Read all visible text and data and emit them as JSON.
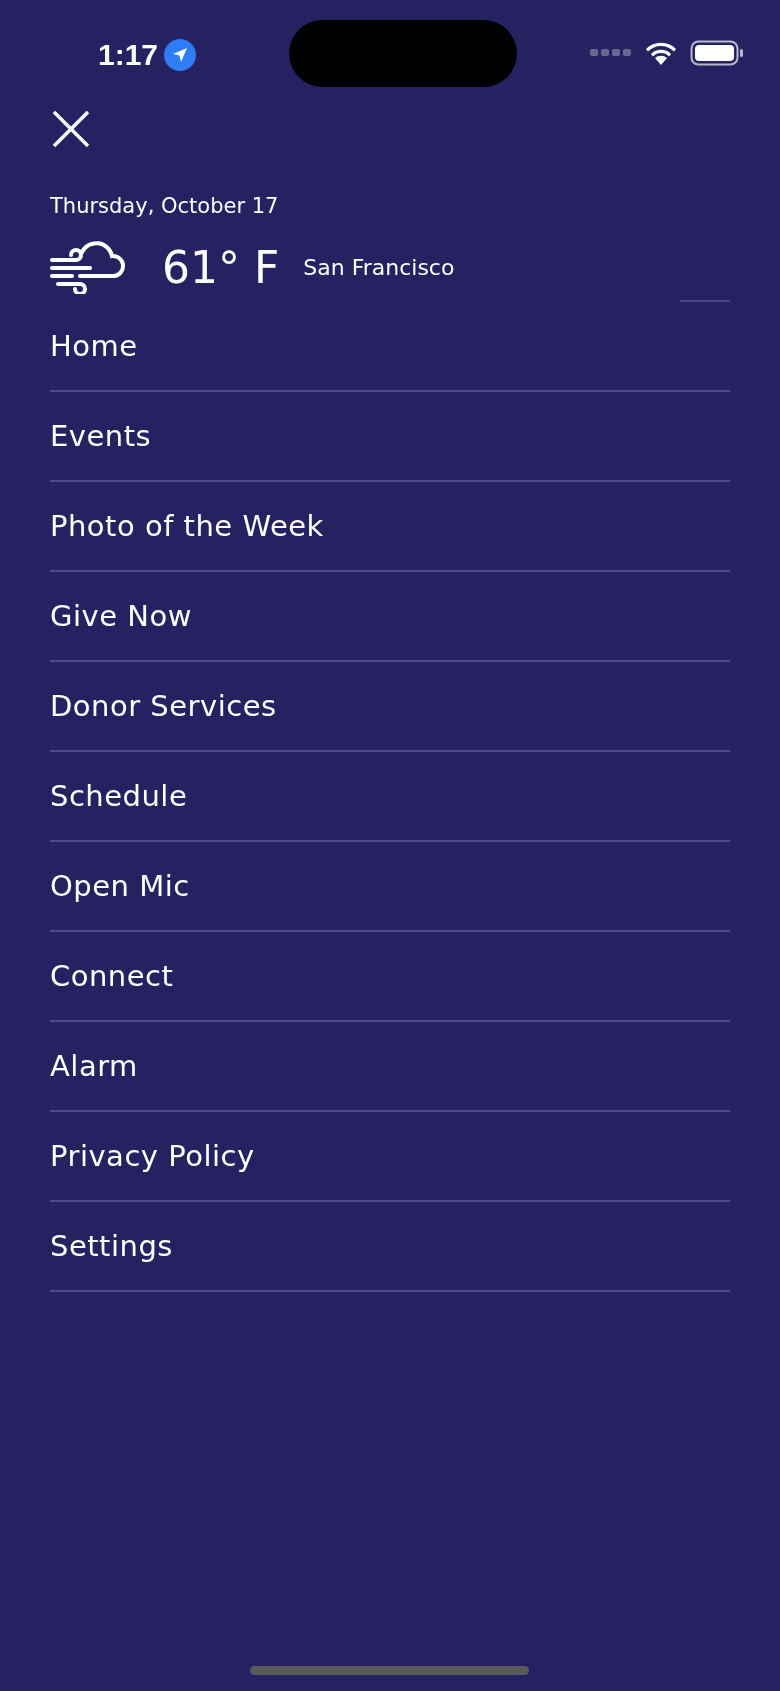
{
  "status_bar": {
    "time": "1:17",
    "location_active": true
  },
  "date": "Thursday, October 17",
  "weather": {
    "temperature": "61° F",
    "city": "San Francisco"
  },
  "menu": [
    {
      "label": "Home"
    },
    {
      "label": "Events"
    },
    {
      "label": "Photo of the Week"
    },
    {
      "label": "Give Now"
    },
    {
      "label": "Donor Services"
    },
    {
      "label": "Schedule"
    },
    {
      "label": "Open Mic"
    },
    {
      "label": "Connect"
    },
    {
      "label": "Alarm"
    },
    {
      "label": "Privacy Policy"
    },
    {
      "label": "Settings"
    }
  ]
}
